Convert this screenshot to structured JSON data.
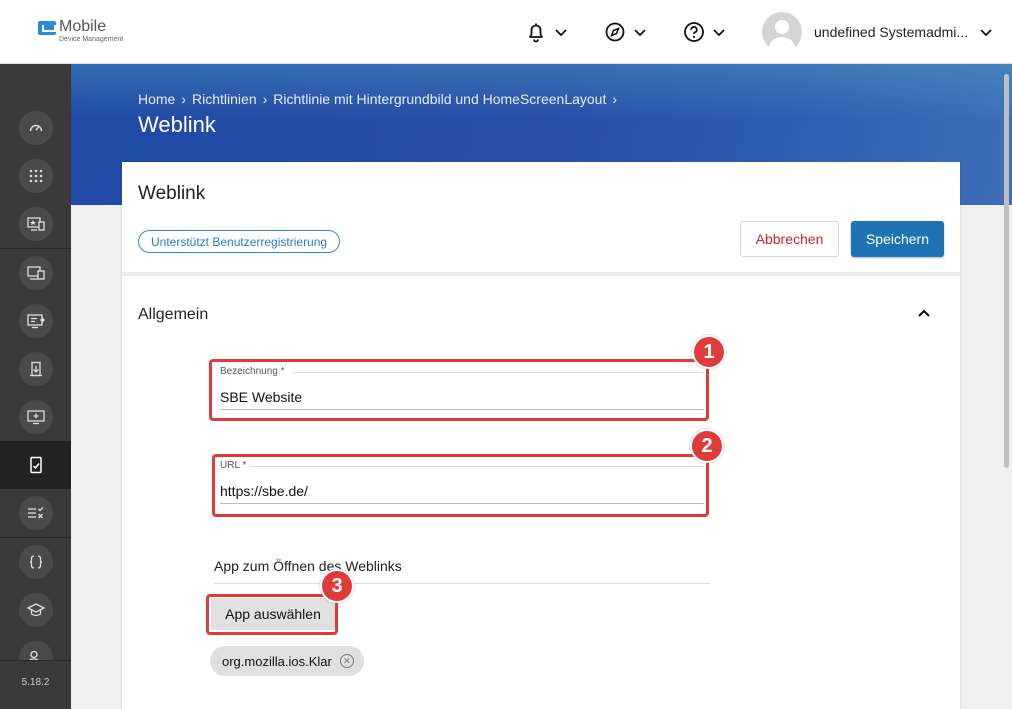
{
  "brand": {
    "title": "Mobile",
    "subtitle": "Device Management"
  },
  "topbar": {
    "icons": [
      "bell-icon",
      "compass-icon",
      "help-icon"
    ],
    "user_name": "undefined Systemadmi..."
  },
  "sidebar": {
    "items": [
      "dashboard-icon",
      "apps-grid-icon",
      "device-star-icon",
      "devices-icon",
      "screen-arrow-icon",
      "download-icon",
      "monitor-icon",
      "policy-icon",
      "list-check-icon",
      "braces-icon",
      "graduation-icon",
      "users-icon"
    ],
    "version": "5.18.2"
  },
  "breadcrumb": {
    "items": [
      "Home",
      "Richtlinien",
      "Richtlinie mit Hintergrundbild und HomeScreenLayout"
    ]
  },
  "page_title": "Weblink",
  "card": {
    "title": "Weblink",
    "badge": "Unterstützt Benutzerregistrierung",
    "cancel_label": "Abbrechen",
    "save_label": "Speichern"
  },
  "section": {
    "title": "Allgemein"
  },
  "fields": {
    "name": {
      "label": "Bezeichnung *",
      "value": "SBE Website"
    },
    "url": {
      "label": "URL *",
      "value": "https://sbe.de/"
    }
  },
  "app": {
    "label": "App zum Öffnen des Weblinks",
    "select_label": "App auswählen",
    "chip": "org.mozilla.ios.Klar",
    "chip_remove": "⊗"
  },
  "markers": [
    "1",
    "2",
    "3"
  ],
  "colors": {
    "accent": "#1e73b5",
    "highlight": "#e03b3b",
    "cancel": "#c62828"
  }
}
